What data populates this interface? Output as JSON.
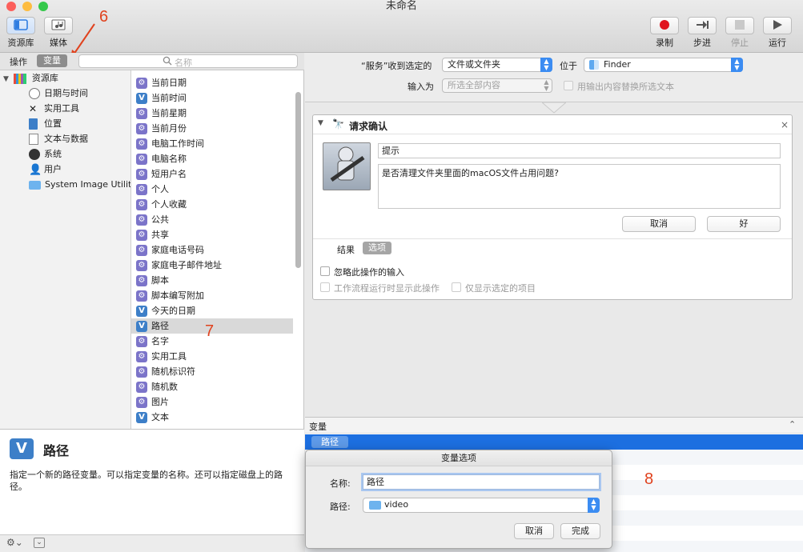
{
  "window": {
    "title": "未命名"
  },
  "toolbar": {
    "left": [
      {
        "label": "资源库",
        "icon": "library-icon"
      },
      {
        "label": "媒体",
        "icon": "media-icon"
      }
    ],
    "right": [
      {
        "label": "录制",
        "icon": "record-icon"
      },
      {
        "label": "步进",
        "icon": "step-icon"
      },
      {
        "label": "停止",
        "icon": "stop-icon"
      },
      {
        "label": "运行",
        "icon": "run-icon"
      }
    ]
  },
  "annotations": {
    "a6": "6",
    "a7": "7",
    "a8": "8"
  },
  "ops_bar": {
    "actions_tab": "操作",
    "variables_tab": "变量",
    "search_placeholder": "名称"
  },
  "library": {
    "root": "资源库",
    "items": [
      "日期与时间",
      "实用工具",
      "位置",
      "文本与数据",
      "系统",
      "用户",
      "System Image Utility"
    ]
  },
  "variables_list": [
    {
      "label": "当前日期",
      "type": "gear"
    },
    {
      "label": "当前时间",
      "type": "v"
    },
    {
      "label": "当前星期",
      "type": "gear"
    },
    {
      "label": "当前月份",
      "type": "gear"
    },
    {
      "label": "电脑工作时间",
      "type": "gear"
    },
    {
      "label": "电脑名称",
      "type": "gear"
    },
    {
      "label": "短用户名",
      "type": "gear"
    },
    {
      "label": "个人",
      "type": "gear"
    },
    {
      "label": "个人收藏",
      "type": "gear"
    },
    {
      "label": "公共",
      "type": "gear"
    },
    {
      "label": "共享",
      "type": "gear"
    },
    {
      "label": "家庭电话号码",
      "type": "gear"
    },
    {
      "label": "家庭电子邮件地址",
      "type": "gear"
    },
    {
      "label": "脚本",
      "type": "gear"
    },
    {
      "label": "脚本编写附加",
      "type": "gear"
    },
    {
      "label": "今天的日期",
      "type": "v"
    },
    {
      "label": "路径",
      "type": "v",
      "selected": true
    },
    {
      "label": "名字",
      "type": "gear"
    },
    {
      "label": "实用工具",
      "type": "gear"
    },
    {
      "label": "随机标识符",
      "type": "gear"
    },
    {
      "label": "随机数",
      "type": "gear"
    },
    {
      "label": "图片",
      "type": "gear"
    },
    {
      "label": "文本",
      "type": "v"
    }
  ],
  "description": {
    "title": "路径",
    "text": "指定一个新的路径变量。可以指定变量的名称。还可以指定磁盘上的路径。"
  },
  "service": {
    "receives_label": "“服务”收到选定的",
    "receives_value": "文件或文件夹",
    "in_label": "位于",
    "in_value": "Finder",
    "input_label": "输入为",
    "input_value": "所选全部内容",
    "replace_label": "用输出内容替换所选文本"
  },
  "action": {
    "title": "请求确认",
    "prompt_title": "提示",
    "prompt_text": "是否清理文件夹里面的macOS文件占用问题?",
    "cancel": "取消",
    "ok": "好",
    "tab_results": "结果",
    "tab_options": "选项",
    "ignore_input": "忽略此操作的输入",
    "show_when_run": "工作流程运行时显示此操作",
    "show_selected_only": "仅显示选定的项目"
  },
  "variables_pane": {
    "header": "变量",
    "selected_var": "路径"
  },
  "dialog": {
    "title": "变量选项",
    "name_label": "名称:",
    "name_value": "路径",
    "path_label": "路径:",
    "path_value": "video",
    "cancel": "取消",
    "done": "完成"
  },
  "colors": {
    "accent": "#3b8cf2",
    "annotation": "#e0421e",
    "selection": "#1c6fe0"
  }
}
